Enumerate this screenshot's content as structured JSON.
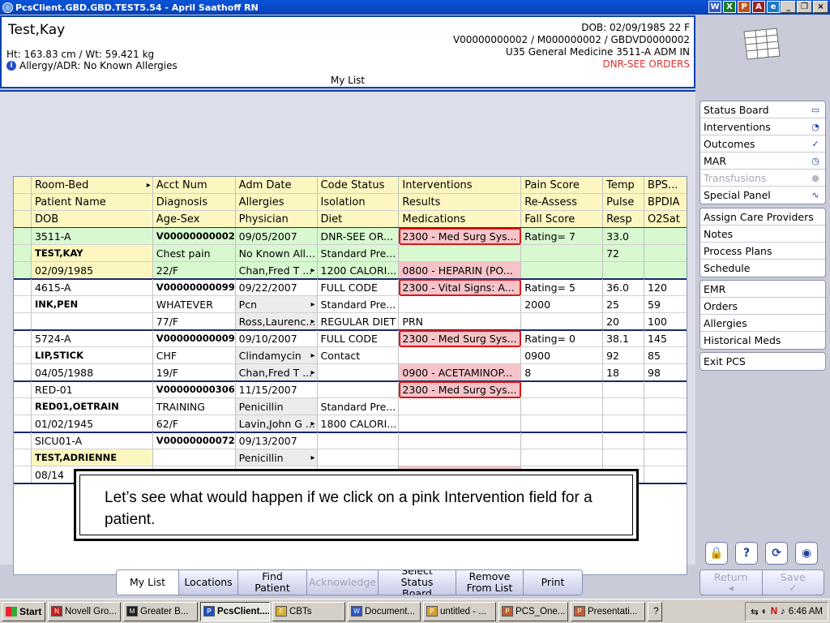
{
  "window": {
    "title": "PcsClient.GBD.GBD.TEST5.54 - April Saathoff RN",
    "toolbar_icons": [
      "W",
      "X",
      "P",
      "A",
      "e"
    ],
    "controls": [
      "_",
      "❐",
      "×"
    ]
  },
  "banner": {
    "patient_name": "Test,Kay",
    "height_weight": "Ht: 163.83 cm / Wt: 59.421 kg",
    "allergy": "Allergy/ADR: No Known Allergies",
    "list_label": "My List",
    "dob_line": "DOB: 02/09/1985 22 F",
    "ids_line": "V00000000002 / M000000002 / GBDVD0000002",
    "unit_line": "U35 General Medicine  3511-A  ADM IN",
    "code_line": "DNR-SEE ORDERS"
  },
  "sidebar": {
    "group1": [
      {
        "label": "Status Board",
        "icon": "book-icon",
        "glyph": "▭",
        "disabled": false
      },
      {
        "label": "Interventions",
        "icon": "clock-icon",
        "glyph": "◔",
        "disabled": false
      },
      {
        "label": "Outcomes",
        "icon": "checklist-icon",
        "glyph": "✓",
        "disabled": false
      },
      {
        "label": "MAR",
        "icon": "mar-icon",
        "glyph": "◷",
        "disabled": false
      },
      {
        "label": "Transfusions",
        "icon": "drop-icon",
        "glyph": "●",
        "disabled": true
      },
      {
        "label": "Special Panel",
        "icon": "waveform-icon",
        "glyph": "∿",
        "disabled": false
      }
    ],
    "group2": [
      "Assign Care Providers",
      "Notes",
      "Process Plans",
      "Schedule"
    ],
    "group3": [
      "EMR",
      "Orders",
      "Allergies",
      "Historical Meds"
    ],
    "group4": [
      "Exit PCS"
    ],
    "tool_icons": [
      "lock-icon",
      "help-icon",
      "refresh-icon",
      "settings-icon"
    ],
    "tool_glyphs": [
      "🔒",
      "?",
      "⟳",
      "◉"
    ]
  },
  "grid": {
    "headers": [
      [
        "Room-Bed",
        "Acct Num",
        "Adm Date",
        "Code Status",
        "Interventions",
        "Pain Score",
        "Temp",
        "BPS..."
      ],
      [
        "Patient Name",
        "Diagnosis",
        "Allergies",
        "Isolation",
        "Results",
        "Re-Assess",
        "Pulse",
        "BPDIA"
      ],
      [
        "DOB",
        "Age-Sex",
        "Physician",
        "Diet",
        "Medications",
        "Fall Score",
        "Resp",
        "O2Sat"
      ]
    ],
    "patients": [
      {
        "rows": [
          [
            "3511-A",
            "V00000000002",
            "09/05/2007",
            "DNR-SEE OR...",
            "2300 - Med Surg Sys...",
            "Rating= 7",
            "33.0",
            ""
          ],
          [
            "TEST,KAY",
            "Chest pain",
            "No Known All...",
            "Standard Pre...",
            "",
            "",
            "72",
            ""
          ],
          [
            "02/09/1985",
            "22/F",
            "Chan,Fred T ...",
            "1200 CALORI...",
            "0800 - HEPARIN (PO...",
            "",
            "",
            ""
          ]
        ]
      },
      {
        "rows": [
          [
            "4615-A",
            "V00000000099",
            "09/22/2007",
            "FULL CODE",
            "2300 - Vital Signs: A...",
            "Rating= 5",
            "36.0",
            "120"
          ],
          [
            "INK,PEN",
            "WHATEVER",
            "Pcn",
            "Standard Pre...",
            "",
            "2000",
            "25",
            "59"
          ],
          [
            "",
            "77/F",
            "Ross,Laurenc...",
            "REGULAR DIET",
            "PRN",
            "",
            "20",
            "100"
          ]
        ]
      },
      {
        "rows": [
          [
            "5724-A",
            "V00000000009",
            "09/10/2007",
            "FULL CODE",
            "2300 - Med Surg Sys...",
            "Rating= 0",
            "38.1",
            "145"
          ],
          [
            "LIP,STICK",
            "CHF",
            "Clindamycin",
            "Contact",
            "",
            "0900",
            "92",
            "85"
          ],
          [
            "04/05/1988",
            "19/F",
            "Chan,Fred T ...",
            "",
            "0900 - ACETAMINOP...",
            "8",
            "18",
            "98"
          ]
        ]
      },
      {
        "rows": [
          [
            "RED-01",
            "V00000000306",
            "11/15/2007",
            "",
            "2300 - Med Surg Sys...",
            "",
            "",
            ""
          ],
          [
            "RED01,OETRAIN",
            "TRAINING",
            "Penicillin",
            "Standard Pre...",
            "",
            "",
            "",
            ""
          ],
          [
            "01/02/1945",
            "62/F",
            "Lavin,John G ...",
            "1800 CALORI...",
            "",
            "",
            "",
            ""
          ]
        ]
      },
      {
        "rows": [
          [
            "SICU01-A",
            "V00000000072",
            "09/13/2007",
            "",
            "",
            "",
            "",
            ""
          ],
          [
            "TEST,ADRIENNE",
            "",
            "Penicillin",
            "",
            "",
            "",
            "",
            ""
          ],
          [
            "08/14",
            "",
            "",
            "",
            "",
            "",
            "",
            ""
          ]
        ]
      }
    ]
  },
  "callout": {
    "text": "Let’s see what would happen if we click on a pink Intervention field for a patient."
  },
  "bottom_tabs": [
    "My List",
    "Locations",
    "Find Patient",
    "Acknowledge",
    "Select Status Board",
    "Remove From List",
    "Print"
  ],
  "bottom_tabs_lines": [
    [
      "My List"
    ],
    [
      "Locations"
    ],
    [
      "Find Patient"
    ],
    [
      "Acknowledge"
    ],
    [
      "Select",
      "Status Board"
    ],
    [
      "Remove",
      "From List"
    ],
    [
      "Print"
    ]
  ],
  "return_label": "Return",
  "save_label": "Save",
  "taskbar": {
    "start": "Start",
    "tasks": [
      "Novell Gro...",
      "Greater B...",
      "PcsClient....",
      "CBTs",
      "Document...",
      "untitled - ...",
      "PCS_One...",
      "Presentati..."
    ],
    "task_icons": [
      "N",
      "M",
      "P",
      "F",
      "W",
      "P",
      "P",
      "P"
    ],
    "clock": "6:46 AM"
  },
  "colors": {
    "banner_border": "#0c3fb0",
    "header_yellow": "#fcf7c0",
    "pink_intervention": "#f6c4c8",
    "highlight_red": "#d81818",
    "selected_green": "#d8f8d0",
    "dnr_red": "#e03030"
  }
}
